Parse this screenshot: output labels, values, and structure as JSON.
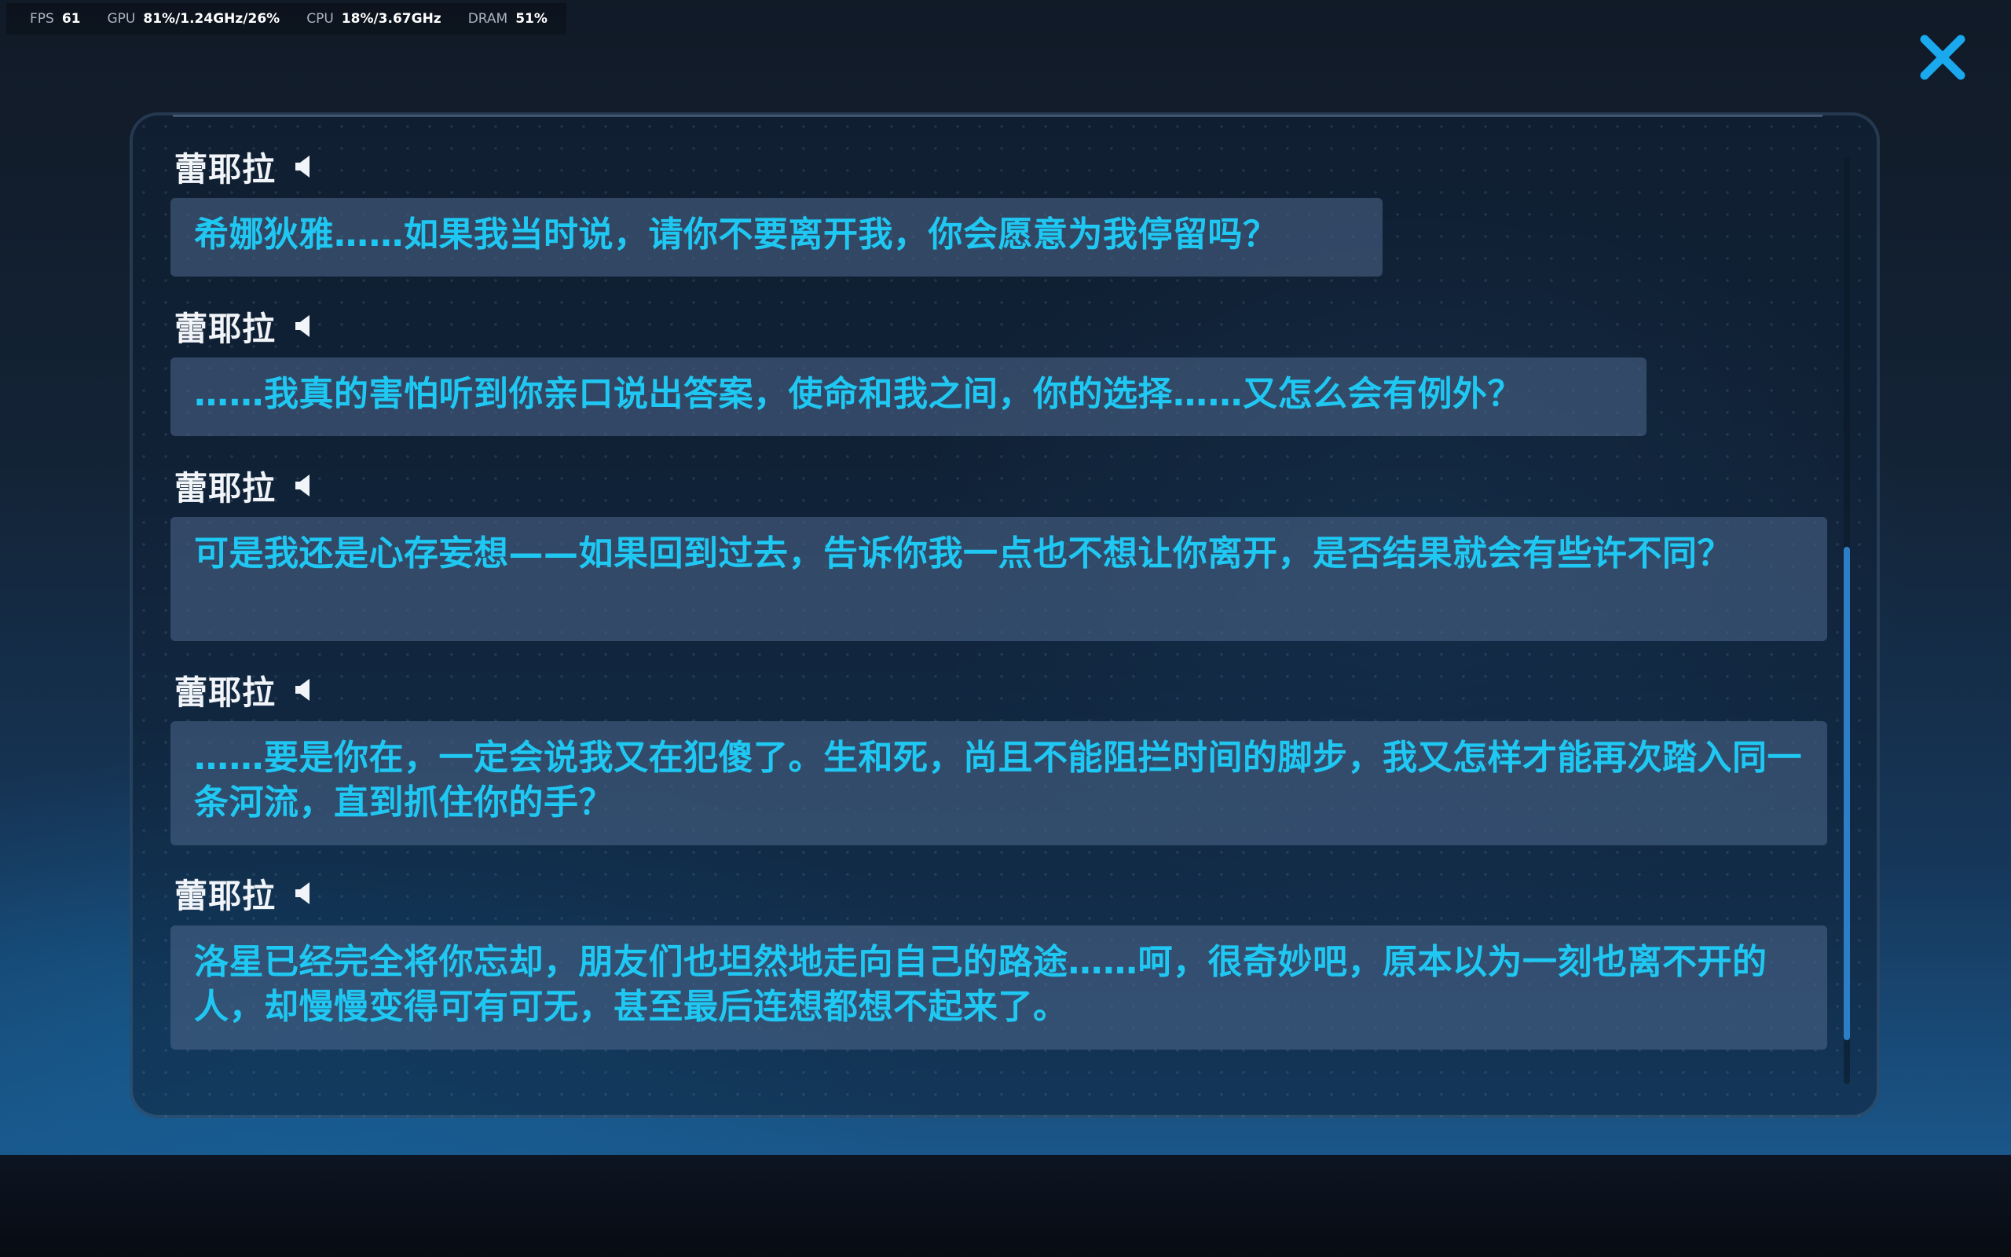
{
  "perf": {
    "fps_label": "FPS",
    "fps_value": "61",
    "gpu_label": "GPU",
    "gpu_value": "81%/1.24GHz/26%",
    "cpu_label": "CPU",
    "cpu_value": "18%/3.67GHz",
    "dram_label": "DRAM",
    "dram_value": "51%"
  },
  "close_button": {
    "icon": "close-icon",
    "color": "#1aa8ee"
  },
  "dialogue": [
    {
      "speaker": "蕾耶拉",
      "icon": "speaker-icon",
      "text": "希娜狄雅……如果我当时说，请你不要离开我，你会愿意为我停留吗？"
    },
    {
      "speaker": "蕾耶拉",
      "icon": "speaker-icon",
      "text": "……我真的害怕听到你亲口说出答案，使命和我之间，你的选择……又怎么会有例外？"
    },
    {
      "speaker": "蕾耶拉",
      "icon": "speaker-icon",
      "text": "可是我还是心存妄想——如果回到过去，告诉你我一点也不想让你离开，是否结果就会有些许不同？"
    },
    {
      "speaker": "蕾耶拉",
      "icon": "speaker-icon",
      "text": "……要是你在，一定会说我又在犯傻了。生和死，尚且不能阻拦时间的脚步，我又怎样才能再次踏入同一条河流，直到抓住你的手？"
    },
    {
      "speaker": "蕾耶拉",
      "icon": "speaker-icon",
      "text": "洛星已经完全将你忘却，朋友们也坦然地走向自己的路途……呵，很奇妙吧，原本以为一刻也离不开的人，却慢慢变得可有可无，甚至最后连想都想不起来了。"
    }
  ],
  "colors": {
    "dialogue_text": "#1fc8f2",
    "speaker_name": "#f1f4f8",
    "scroll_thumb": "#2c7ec6"
  }
}
